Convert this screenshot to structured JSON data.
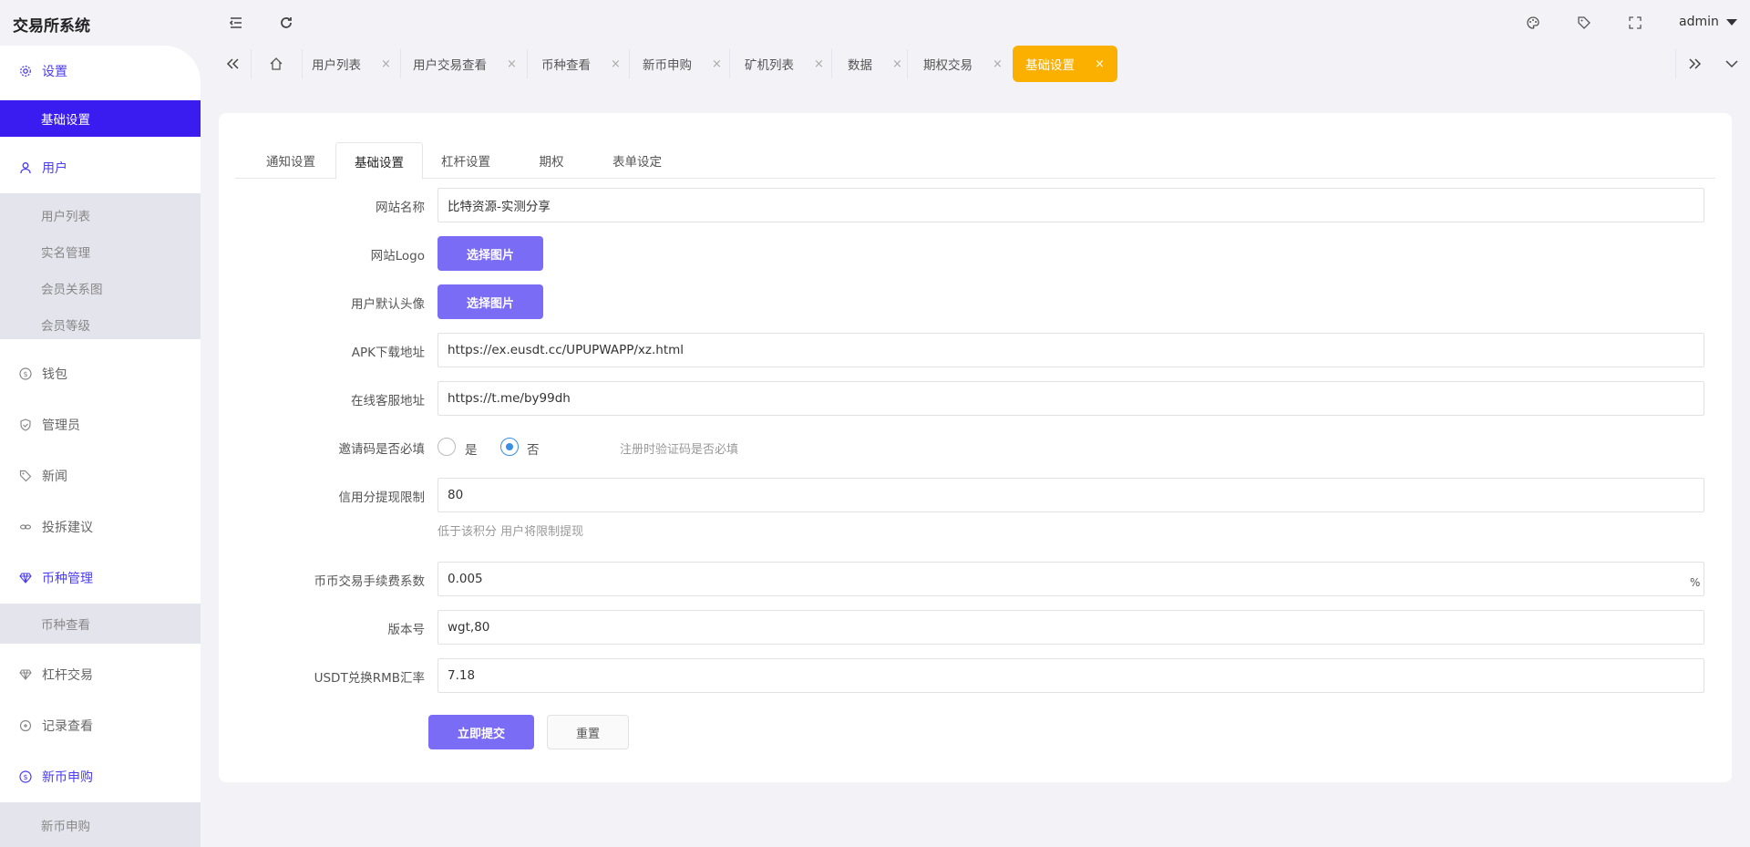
{
  "app": {
    "title": "交易所系统",
    "user": "admin"
  },
  "header_icons": [
    "collapse-menu-icon",
    "refresh-icon",
    "theme-palette-icon",
    "tag-icon",
    "fullscreen-icon"
  ],
  "sidebar": {
    "items": [
      {
        "label": "设置",
        "icon": "gear-icon",
        "active": true,
        "children": [
          {
            "label": "基础设置",
            "selected": true
          }
        ]
      },
      {
        "label": "用户",
        "icon": "user-icon",
        "active": true,
        "children": [
          {
            "label": "用户列表"
          },
          {
            "label": "实名管理"
          },
          {
            "label": "会员关系图"
          },
          {
            "label": "会员等级"
          }
        ]
      },
      {
        "label": "钱包",
        "icon": "dollar-icon"
      },
      {
        "label": "管理员",
        "icon": "shield-icon"
      },
      {
        "label": "新闻",
        "icon": "tag-icon"
      },
      {
        "label": "投拆建议",
        "icon": "link-icon"
      },
      {
        "label": "币种管理",
        "icon": "diamond-icon",
        "active": true,
        "children": [
          {
            "label": "币种查看"
          }
        ]
      },
      {
        "label": "杠杆交易",
        "icon": "diamond-icon"
      },
      {
        "label": "记录查看",
        "icon": "record-icon"
      },
      {
        "label": "新币申购",
        "icon": "dollar-icon",
        "active": true,
        "children": [
          {
            "label": "新币申购"
          }
        ]
      }
    ]
  },
  "tabs": {
    "items": [
      {
        "label": "用户列表"
      },
      {
        "label": "用户交易查看"
      },
      {
        "label": "币种查看"
      },
      {
        "label": "新币申购"
      },
      {
        "label": "矿机列表"
      },
      {
        "label": "数据"
      },
      {
        "label": "期权交易"
      },
      {
        "label": "基础设置",
        "active": true
      }
    ],
    "close_glyph": "×"
  },
  "form_tabs": [
    {
      "label": "通知设置"
    },
    {
      "label": "基础设置",
      "active": true
    },
    {
      "label": "杠杆设置"
    },
    {
      "label": "期权"
    },
    {
      "label": "表单设定"
    }
  ],
  "form": {
    "site_name": {
      "label": "网站名称",
      "value": "比特资源-实测分享"
    },
    "site_logo": {
      "label": "网站Logo",
      "button": "选择图片"
    },
    "default_avatar": {
      "label": "用户默认头像",
      "button": "选择图片"
    },
    "apk_url": {
      "label": "APK下载地址",
      "value": "https://ex.eusdt.cc/UPUPWAPP/xz.html"
    },
    "service_url": {
      "label": "在线客服地址",
      "value": "https://t.me/by99dh"
    },
    "invite_required": {
      "label": "邀请码是否必填",
      "options": [
        "是",
        "否"
      ],
      "selected": "否",
      "hint": "注册时验证码是否必填"
    },
    "credit_limit": {
      "label": "信用分提现限制",
      "value": "80",
      "hint": "低于该积分 用户将限制提现"
    },
    "fee_rate": {
      "label": "币币交易手续费系数",
      "value": "0.005",
      "suffix": "%"
    },
    "version": {
      "label": "版本号",
      "value": "wgt,80"
    },
    "usdt_rate": {
      "label": "USDT兑换RMB汇率",
      "value": "7.18"
    },
    "submit_label": "立即提交",
    "reset_label": "重置"
  },
  "colors": {
    "primary": "#7b6cf6",
    "menu_selected": "#3a1cf0",
    "tab_active": "#fbb000",
    "menu_active_text": "#4a3cf0",
    "radio": "#3a8ee6"
  }
}
